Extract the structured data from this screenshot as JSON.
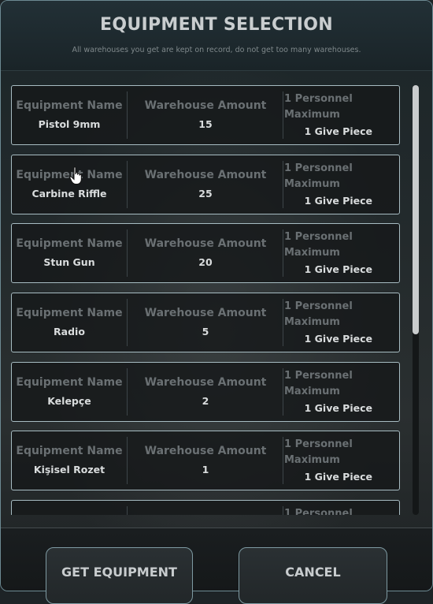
{
  "header": {
    "title": "EQUIPMENT SELECTION",
    "subtitle": "All warehouses you get are kept on record, do not get too many warehouses."
  },
  "columns": {
    "name_label": "Equipment Name",
    "amount_label": "Warehouse Amount",
    "limit_label_line1": "1 Personnel",
    "limit_label_line2": "Maximum",
    "limit_value": "1 Give Piece"
  },
  "items": [
    {
      "name": "Pistol 9mm",
      "amount": "15"
    },
    {
      "name": "Carbine Riffle",
      "amount": "25"
    },
    {
      "name": "Stun Gun",
      "amount": "20"
    },
    {
      "name": "Radio",
      "amount": "5"
    },
    {
      "name": "Kelepçe",
      "amount": "2"
    },
    {
      "name": "Kişisel Rozet",
      "amount": "1"
    },
    {
      "name": "",
      "amount": ""
    }
  ],
  "buttons": {
    "get_label": "GET EQUIPMENT",
    "cancel_label": "CANCEL"
  },
  "icons": {
    "cursor": "hand-pointer-icon"
  },
  "colors": {
    "border_accent": "#a7bcc2",
    "text_primary": "#d9dcdd",
    "text_muted": "#6a7073"
  }
}
